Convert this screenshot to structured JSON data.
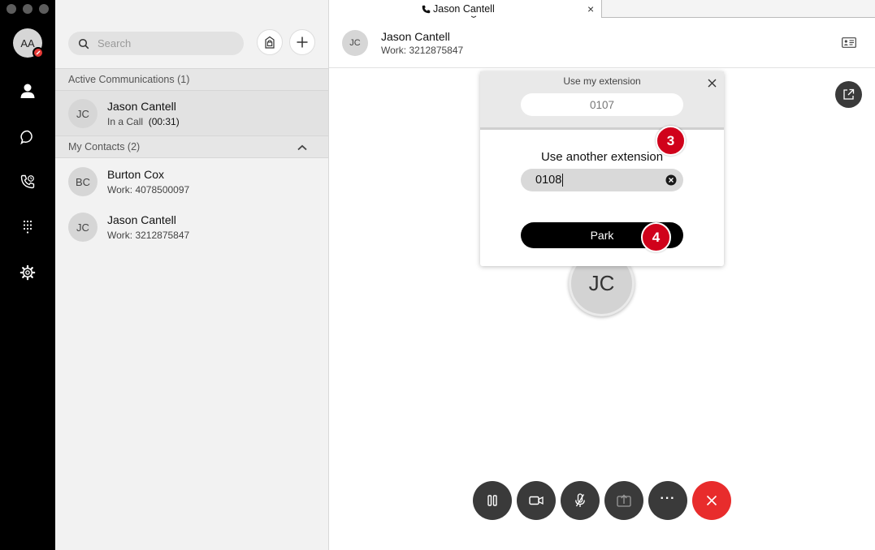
{
  "colors": {
    "rail": "#000000",
    "accent_red": "#e82c2c",
    "step_badge": "#d0021b",
    "control_dark": "#3a3a3a"
  },
  "me": {
    "initials": "AA"
  },
  "search": {
    "placeholder": "Search"
  },
  "active_section": {
    "label": "Active Communications (1)"
  },
  "active_call": {
    "initials": "JC",
    "name": "Jason Cantell",
    "status": "In a Call",
    "duration": "(00:31)"
  },
  "contacts_section": {
    "label": "My Contacts (2)"
  },
  "contacts": [
    {
      "initials": "BC",
      "name": "Burton Cox",
      "detail": "Work: 4078500097"
    },
    {
      "initials": "JC",
      "name": "Jason Cantell",
      "detail": "Work: 3212875847"
    }
  ],
  "tab": {
    "title": "Jason Cantell",
    "close": "×"
  },
  "call_header": {
    "initials": "JC",
    "name": "Jason Cantell",
    "detail": "Work: 3212875847"
  },
  "park": {
    "my_extension_title": "Use my extension",
    "my_extension_value": "0107",
    "another_title": "Use another extension",
    "another_value": "0108",
    "park_label": "Park",
    "step_a": "3",
    "step_b": "4"
  },
  "big_avatar": {
    "initials": "JC"
  },
  "controls": [
    "hold-icon",
    "video-icon",
    "mute-icon",
    "share-icon",
    "more-icon",
    "end-call-icon"
  ],
  "more_label": "···"
}
